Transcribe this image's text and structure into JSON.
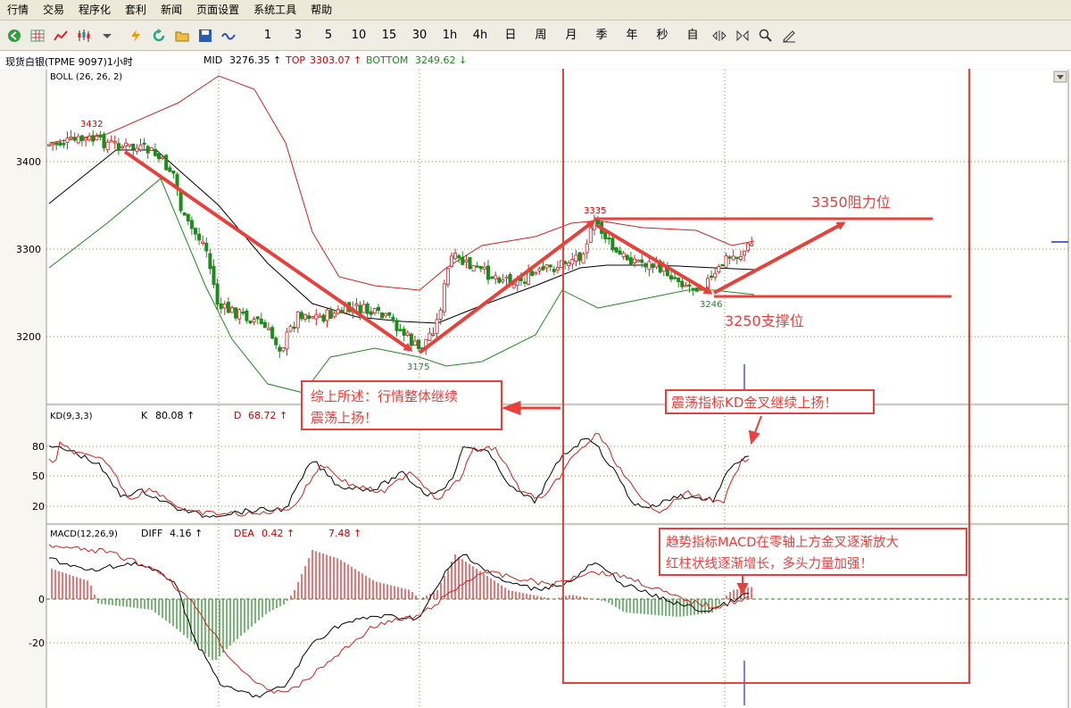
{
  "menu": [
    "行情",
    "交易",
    "程序化",
    "套利",
    "新闻",
    "页面设置",
    "系统工具",
    "帮助"
  ],
  "toolbar": {
    "icons": [
      "back-icon",
      "grid-icon",
      "line-chart-icon",
      "candle-icon",
      "dropdown-icon",
      "lightning-icon",
      "refresh-icon",
      "folder-icon",
      "save-icon",
      "wave-icon"
    ],
    "periods": [
      "1",
      "3",
      "5",
      "10",
      "15",
      "30",
      "1h",
      "4h",
      "日",
      "周",
      "月",
      "季",
      "年",
      "秒",
      "自"
    ],
    "tools": [
      "zoom-horizontal-icon",
      "split-icon",
      "search-icon",
      "draw-pen-icon"
    ]
  },
  "info": {
    "symbol": "现货白银(TPME 9097)1小时",
    "mid_label": "MID",
    "mid_value": "3276.35 ↑",
    "top_label": "TOP",
    "top_value": "3303.07 ↑",
    "bottom_label": "BOTTOM",
    "bottom_value": "3249.62 ↓"
  },
  "panels": {
    "boll_label": "BOLL (26, 26, 2)",
    "kd_label": "KD(9,3,3)",
    "kd_k_label": "K",
    "kd_k_value": "80.08 ↑",
    "kd_d_label": "D",
    "kd_d_value": "68.72 ↑",
    "macd_label": "MACD(12,26,9)",
    "macd_diff_label": "DIFF",
    "macd_diff_value": "4.16 ↑",
    "macd_dea_label": "DEA",
    "macd_dea_value": "0.42 ↑",
    "macd_value": "7.48 ↑"
  },
  "axes": {
    "price_ticks": [
      "3400",
      "3300",
      "3200"
    ],
    "kd_ticks": [
      "80",
      "50",
      "20"
    ],
    "macd_ticks": [
      "0",
      "-20"
    ]
  },
  "price_labels": {
    "high1": "3432",
    "low1": "3175",
    "high2": "3335",
    "low2": "3246"
  },
  "annotations": {
    "resistance": "3350阻力位",
    "support": "3250支撑位",
    "summary_line1": "综上所述：行情整体继续",
    "summary_line2": "震荡上扬！",
    "kd_note": "震荡指标KD金叉继续上扬！",
    "macd_note_line1": "趋势指标MACD在零轴上方金叉逐渐放大",
    "macd_note_line2": "红柱状线逐渐增长，多头力量加强！"
  },
  "colors": {
    "annotation_red": "#e8403b",
    "up": "#d42020",
    "down": "#1f8a1f",
    "grid": "#9a9a6a"
  }
}
